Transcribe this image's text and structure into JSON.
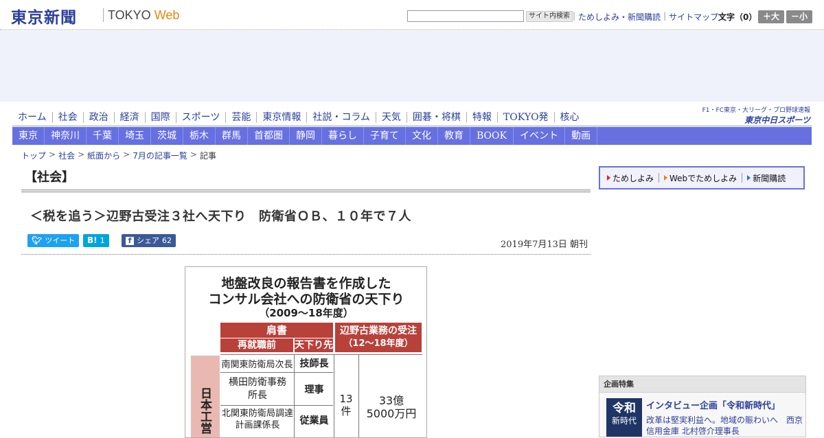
{
  "header": {
    "logo_jp": "東京新聞",
    "logo_en_a": "TOKYO",
    "logo_en_b": "Web",
    "search_placeholder": "",
    "search_button": "サイト内検索",
    "links": [
      "ためしよみ・新聞購読",
      "サイトマップ"
    ],
    "font_size_label": "文字（0）",
    "font_plus": "＋大",
    "font_minus": "－小"
  },
  "main_nav": [
    "ホーム",
    "社会",
    "政治",
    "経済",
    "国際",
    "スポーツ",
    "芸能",
    "東京情報",
    "社説・コラム",
    "天気",
    "囲碁・将棋",
    "特報",
    "TOKYO発",
    "核心"
  ],
  "sports_link": {
    "line1": "F1・FC東京・大リーグ・プロ野球速報",
    "line2": "東京中日スポーツ"
  },
  "sub_nav": [
    "東京",
    "神奈川",
    "千葉",
    "埼玉",
    "茨城",
    "栃木",
    "群馬",
    "首都圏",
    "静岡",
    "暮らし",
    "子育て",
    "文化",
    "教育",
    "BOOK",
    "イベント",
    "動画"
  ],
  "breadcrumb": [
    "トップ",
    "社会",
    "紙面から",
    "7月の記事一覧",
    "記事"
  ],
  "article": {
    "section": "【社会】",
    "title": "＜税を追う＞辺野古受注３社へ天下り　防衛省ＯＢ、１０年で７人",
    "tweet_label": "ツイート",
    "hatena_label": "B!",
    "hatena_count": "1",
    "facebook_label": "シェア",
    "facebook_count": "62",
    "date": "2019年7月13日 朝刊"
  },
  "figure": {
    "title1": "地盤改良の報告書を作成した",
    "title2": "コンサル会社への防衛省の天下り",
    "title3": "（2009～18年度）",
    "header_katagaki": "肩書",
    "header_prev": "再就職前",
    "header_dest": "天下り先",
    "header_order1": "辺野古業務の受注",
    "header_order2": "（12～18年度）",
    "rows": [
      {
        "prev": "南関東防衛局次長",
        "dest": "技師長"
      },
      {
        "prev": "横田防衛事務所長",
        "dest": "理事"
      },
      {
        "prev": "北関東防衛局調達計画課係長",
        "dest": "従業員"
      }
    ],
    "count": "13件",
    "amount1": "33億",
    "amount2": "5000万円",
    "company": "日本工営"
  },
  "sidebar": {
    "buttons": [
      "ためしよみ",
      "Webでためしよみ",
      "新聞購読"
    ],
    "kikaku_header": "企画特集",
    "reiwa_badge_1": "令和",
    "reiwa_badge_2": "新時代",
    "kikaku_title": "インタビュー企画「令和新時代」",
    "kikaku_desc": "改革は堅実利益へ。地域の賑わいへ　西京信用金庫 北村啓介理事長"
  }
}
